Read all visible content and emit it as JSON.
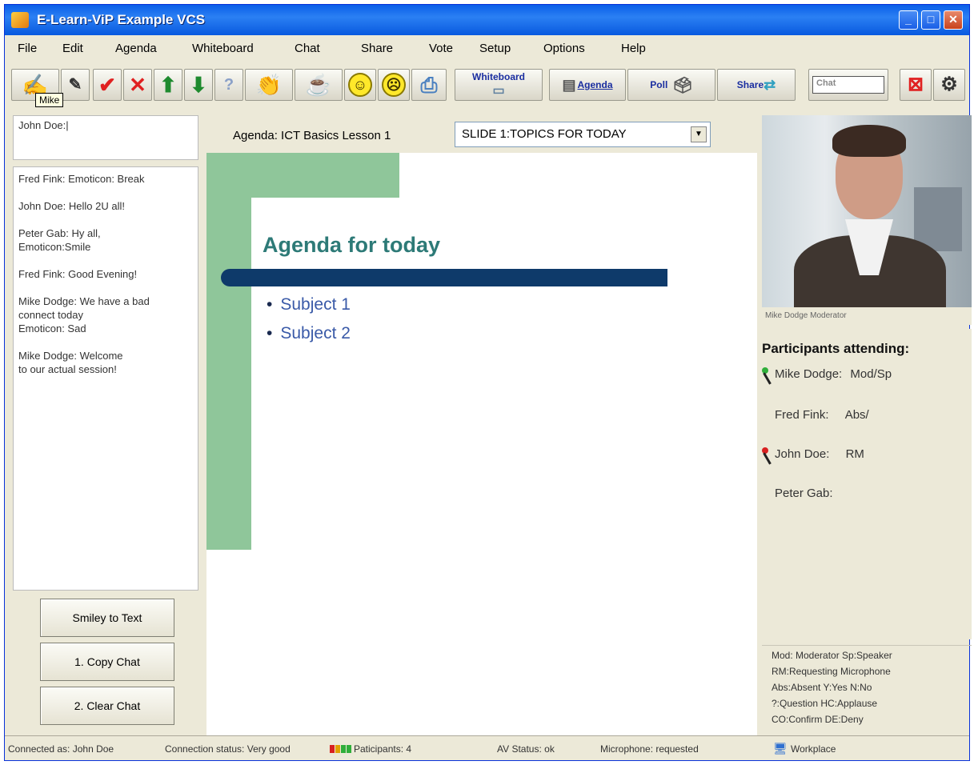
{
  "window": {
    "title": "E-Learn-ViP Example VCS"
  },
  "menu": [
    "File",
    "Edit",
    "Agenda",
    "Whiteboard",
    "Chat",
    "Share",
    "Vote",
    "Setup",
    "Options",
    "Help"
  ],
  "toolbar": {
    "tooltip": "Mike",
    "whiteboard_label": "Whiteboard",
    "agenda_label": "Agenda",
    "poll_label": "Poll",
    "share_label": "Share",
    "chat_placeholder": "Chat"
  },
  "chat": {
    "input_value": "John Doe:|",
    "messages": [
      "Fred Fink: Emoticon: Break",
      "John Doe: Hello 2U all!",
      "Peter Gab: Hy all,\nEmoticon:Smile",
      "Fred Fink: Good Evening!",
      "Mike Dodge: We have a bad\nconnect today\nEmoticon: Sad",
      "Mike Dodge: Welcome\nto our actual session!"
    ],
    "smiley_button": "Smiley to Text",
    "copy_button": "1. Copy Chat",
    "clear_button": "2. Clear Chat"
  },
  "agenda": {
    "label": "Agenda: ICT Basics Lesson 1",
    "selected_slide": "SLIDE 1:TOPICS FOR TODAY"
  },
  "slide": {
    "heading": "Agenda for today",
    "bullets": [
      "Subject 1",
      "Subject 2"
    ]
  },
  "video": {
    "caption": "Mike Dodge Moderator"
  },
  "participants": {
    "title": "Participants attending:",
    "list": [
      {
        "name": "Mike Dodge:",
        "status": "Mod/Sp",
        "mic_color": "#2fae3a"
      },
      {
        "name": "Fred Fink:",
        "status": "Abs/",
        "mic_color": ""
      },
      {
        "name": "John Doe:",
        "status": "RM",
        "mic_color": "#d82020"
      },
      {
        "name": "Peter Gab:",
        "status": "",
        "mic_color": ""
      }
    ]
  },
  "legend": [
    "Mod: Moderator Sp:Speaker",
    "RM:Requesting Microphone",
    "Abs:Absent Y:Yes N:No",
    "?:Question HC:Applause",
    "CO:Confirm DE:Deny"
  ],
  "status": {
    "connected": "Connected as: John Doe",
    "connection": "Connection status: Very good",
    "participants": "Paticipants: 4",
    "av": "AV Status: ok",
    "microphone": "Microphone: requested",
    "workplace": "Workplace"
  },
  "colors": {
    "accent": "#0a5ee8",
    "slide_green": "#8fc69a",
    "slide_navy": "#0e3a6a",
    "slide_heading": "#2d7a77"
  }
}
